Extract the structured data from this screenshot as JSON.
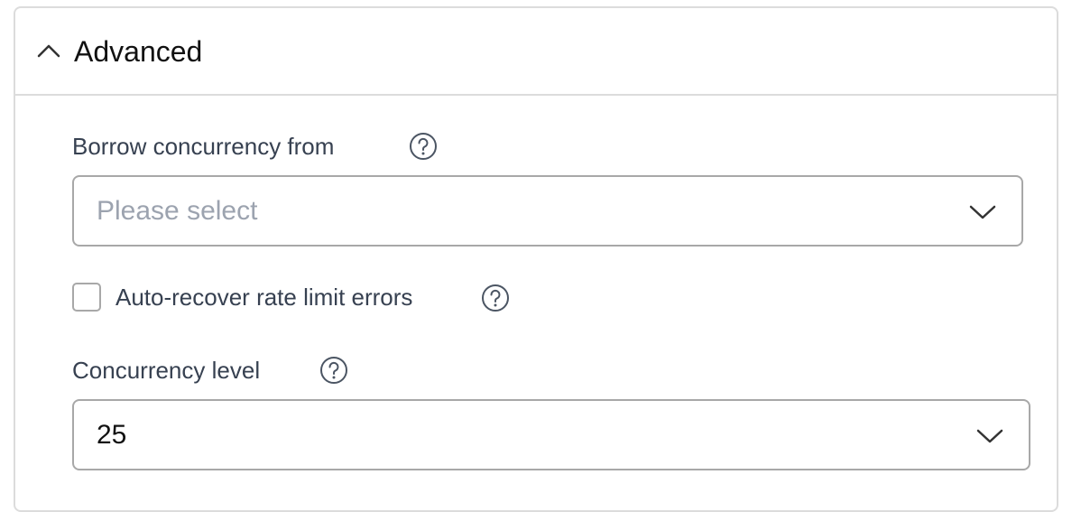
{
  "section": {
    "title": "Advanced",
    "expanded": true
  },
  "borrow": {
    "label": "Borrow concurrency from",
    "placeholder": "Please select",
    "help_icon": "question-circle-icon"
  },
  "auto_recover": {
    "label": "Auto-recover rate limit errors",
    "checked": false,
    "help_icon": "question-circle-icon"
  },
  "concurrency": {
    "label": "Concurrency level",
    "value": "25",
    "help_icon": "question-circle-icon"
  },
  "colors": {
    "border": "#dcdcdc",
    "input_border": "#a8a8a8",
    "placeholder": "#9ca3af",
    "label": "#374151"
  }
}
